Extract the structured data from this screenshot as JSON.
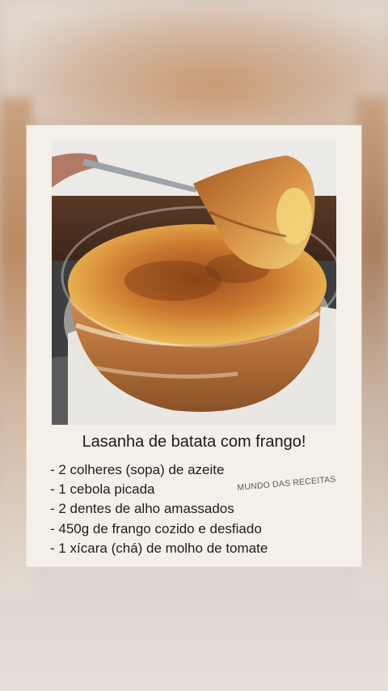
{
  "recipe": {
    "title": "Lasanha de batata com frango!",
    "ingredients": [
      "- 2 colheres (sopa) de azeite",
      "- 1 cebola picada",
      "- 2 dentes de alho amassados",
      "- 450g de frango cozido e desfiado",
      "- 1 xícara (chá) de molho de tomate"
    ],
    "watermark": "MUNDO DAS RECEITAS"
  }
}
